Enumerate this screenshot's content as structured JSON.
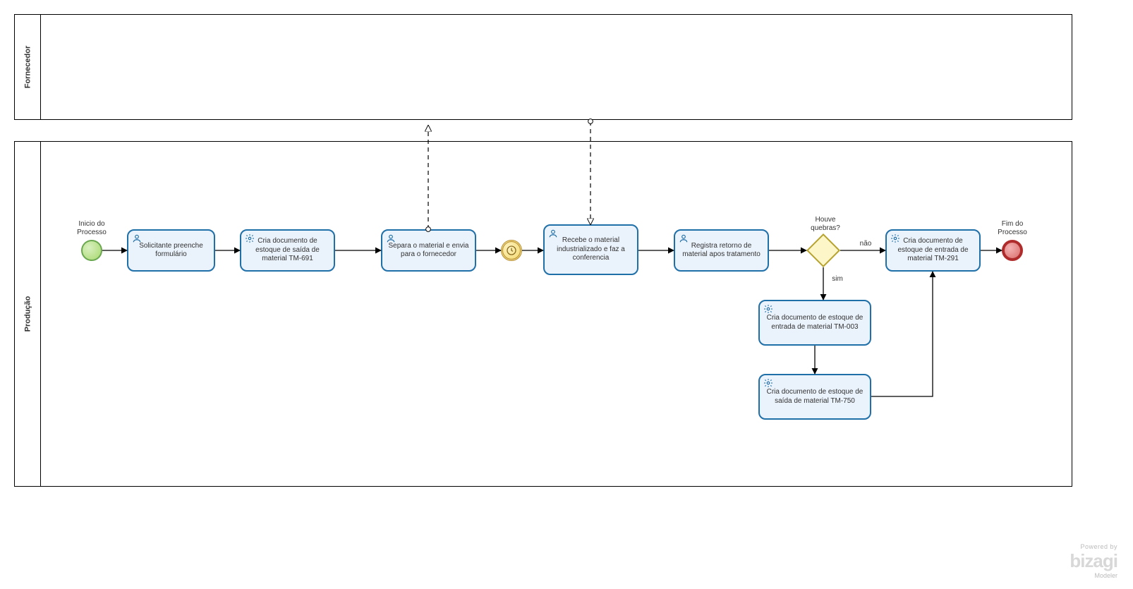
{
  "diagram": {
    "type": "BPMN",
    "pools": [
      {
        "id": "pool-fornecedor",
        "name": "Fornecedor"
      },
      {
        "id": "pool-producao",
        "name": "Produção"
      }
    ],
    "labels": {
      "start": "Inicio do Processo",
      "end": "Fim do Processo",
      "gateway_question": "Houve quebras?",
      "branch_no": "não",
      "branch_yes": "sim"
    },
    "tasks": {
      "t1": {
        "text": "Solicitante preenche formulário",
        "type": "user"
      },
      "t2": {
        "text": "Cria documento de estoque de saída de material  TM-691",
        "type": "service"
      },
      "t3": {
        "text": "Separa o material e envia para o fornecedor",
        "type": "user"
      },
      "t4": {
        "text": "Recebe o material industrializado e faz a conferencia",
        "type": "user"
      },
      "t5": {
        "text": "Registra retorno de material apos tratamento",
        "type": "user"
      },
      "t6": {
        "text": "Cria documento de estoque de entrada de material  TM-291",
        "type": "service"
      },
      "t7": {
        "text": "Cria documento de estoque de entrada de material TM-003",
        "type": "service"
      },
      "t8": {
        "text": "Cria documento de estoque de saída de material  TM-750",
        "type": "service"
      }
    },
    "events": {
      "start": {
        "type": "start"
      },
      "timer": {
        "type": "timer-intermediate"
      },
      "end": {
        "type": "end"
      }
    },
    "gateways": {
      "g1": {
        "type": "exclusive",
        "question": "Houve quebras?"
      }
    },
    "sequence_flows": [
      {
        "from": "start",
        "to": "t1"
      },
      {
        "from": "t1",
        "to": "t2"
      },
      {
        "from": "t2",
        "to": "t3"
      },
      {
        "from": "t3",
        "to": "timer"
      },
      {
        "from": "timer",
        "to": "t4"
      },
      {
        "from": "t4",
        "to": "t5"
      },
      {
        "from": "t5",
        "to": "g1"
      },
      {
        "from": "g1",
        "to": "t6",
        "label": "não"
      },
      {
        "from": "g1",
        "to": "t7",
        "label": "sim"
      },
      {
        "from": "t7",
        "to": "t8"
      },
      {
        "from": "t8",
        "to": "t6"
      },
      {
        "from": "t6",
        "to": "end"
      }
    ],
    "message_flows": [
      {
        "from": "t3",
        "to": "pool-fornecedor"
      },
      {
        "from": "pool-fornecedor",
        "to": "t4"
      }
    ]
  },
  "branding": {
    "powered_by": "Powered by",
    "name": "bizagi",
    "product": "Modeler"
  }
}
